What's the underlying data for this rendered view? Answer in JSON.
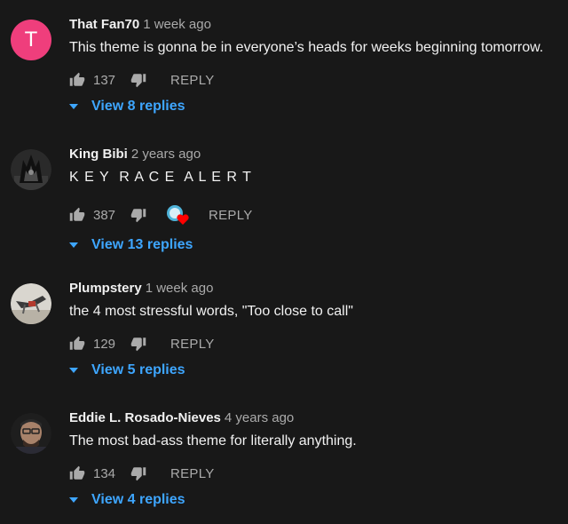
{
  "comments": [
    {
      "avatar_letter": "T",
      "author": "That Fan70",
      "time": "1 week ago",
      "text": "This theme is gonna be in everyone’s heads for weeks beginning tomorrow.",
      "likes": "137",
      "reply_label": "REPLY",
      "view_replies": "View 8 replies"
    },
    {
      "author": "King Bibi",
      "time": "2 years ago",
      "text": "K E Y  R A C E  A L E R T",
      "likes": "387",
      "reply_label": "REPLY",
      "view_replies": "View 13 replies"
    },
    {
      "author": "Plumpstery",
      "time": "1 week ago",
      "text": "the 4 most stressful words, \"Too close to call\"",
      "likes": "129",
      "reply_label": "REPLY",
      "view_replies": "View 5 replies"
    },
    {
      "author": "Eddie L. Rosado-Nieves",
      "time": "4 years ago",
      "text": "The most bad-ass theme for literally anything.",
      "likes": "134",
      "reply_label": "REPLY",
      "view_replies": "View 4 replies"
    }
  ],
  "colors": {
    "background": "#181818",
    "link": "#3ea6ff",
    "secondary_text": "#aaaaaa",
    "avatar_T": "#ef3e7c",
    "heart": "#ff0000"
  }
}
